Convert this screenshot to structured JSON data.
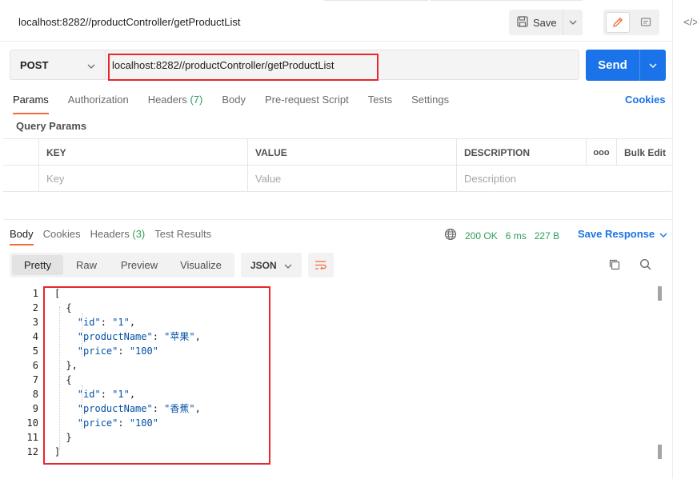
{
  "request": {
    "title": "localhost:8282//productController/getProductList",
    "method": "POST",
    "url": "localhost:8282//productController/getProductList",
    "save_label": "Save",
    "send_label": "Send"
  },
  "request_tabs": [
    {
      "label": "Params",
      "count": ""
    },
    {
      "label": "Authorization",
      "count": ""
    },
    {
      "label": "Headers",
      "count": "(7)"
    },
    {
      "label": "Body",
      "count": ""
    },
    {
      "label": "Pre-request Script",
      "count": ""
    },
    {
      "label": "Tests",
      "count": ""
    },
    {
      "label": "Settings",
      "count": ""
    }
  ],
  "cookies_link": "Cookies",
  "query_params": {
    "title": "Query Params",
    "headers": {
      "key": "KEY",
      "value": "VALUE",
      "description": "DESCRIPTION",
      "more": "ooo",
      "bulk_edit": "Bulk Edit"
    },
    "placeholders": {
      "key": "Key",
      "value": "Value",
      "description": "Description"
    }
  },
  "response_tabs": [
    {
      "label": "Body",
      "count": ""
    },
    {
      "label": "Cookies",
      "count": ""
    },
    {
      "label": "Headers",
      "count": "(3)"
    },
    {
      "label": "Test Results",
      "count": ""
    }
  ],
  "response_status": {
    "status": "200 OK",
    "time": "6 ms",
    "size": "227 B",
    "save_response": "Save Response"
  },
  "view_modes": [
    "Pretty",
    "Raw",
    "Preview",
    "Visualize"
  ],
  "format": "JSON",
  "code_lines": [
    {
      "n": "1",
      "text": "["
    },
    {
      "n": "2",
      "text": "{"
    },
    {
      "n": "3",
      "key": "\"id\"",
      "sep": ": ",
      "val": "\"1\"",
      "end": ","
    },
    {
      "n": "4",
      "key": "\"productName\"",
      "sep": ": ",
      "val": "\"苹果\"",
      "end": ","
    },
    {
      "n": "5",
      "key": "\"price\"",
      "sep": ": ",
      "val": "\"100\"",
      "end": ""
    },
    {
      "n": "6",
      "text": "},"
    },
    {
      "n": "7",
      "text": "{"
    },
    {
      "n": "8",
      "key": "\"id\"",
      "sep": ": ",
      "val": "\"1\"",
      "end": ","
    },
    {
      "n": "9",
      "key": "\"productName\"",
      "sep": ": ",
      "val": "\"香蕉\"",
      "end": ","
    },
    {
      "n": "10",
      "key": "\"price\"",
      "sep": ": ",
      "val": "\"100\"",
      "end": ""
    },
    {
      "n": "11",
      "text": "}"
    },
    {
      "n": "12",
      "text": "]"
    }
  ],
  "colors": {
    "accent": "#f26b3a",
    "primary": "#1a73e8",
    "success": "#2e9e5b",
    "highlight": "#e8262b"
  }
}
